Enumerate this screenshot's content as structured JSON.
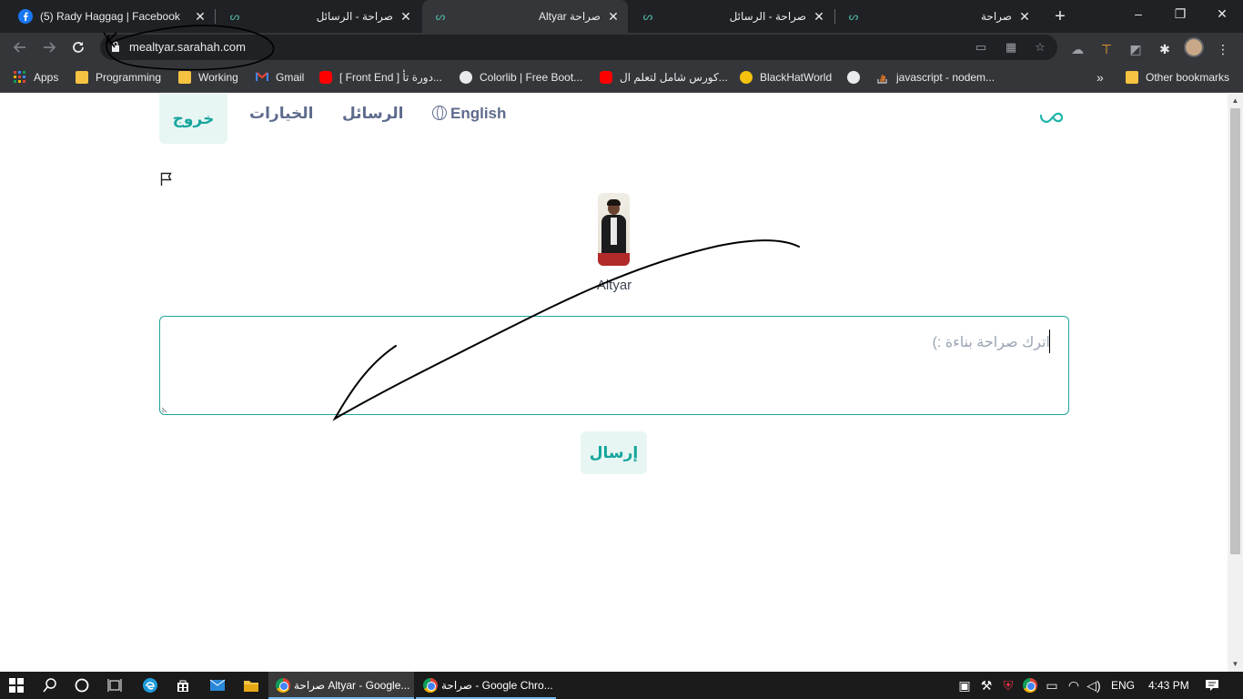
{
  "browser": {
    "tabs": [
      {
        "title": "(5) Rady Haggag | Facebook",
        "favicon": "facebook-icon"
      },
      {
        "title": "صراحة - الرسائل",
        "favicon": "sarahah-icon"
      },
      {
        "title": "Altyar صراحة",
        "favicon": "sarahah-icon"
      },
      {
        "title": "صراحة - الرسائل",
        "favicon": "sarahah-icon"
      },
      {
        "title": "صراحة",
        "favicon": "sarahah-icon"
      }
    ],
    "new_tab": "+",
    "window_controls": {
      "minimize": "–",
      "maximize": "❐",
      "close": "✕"
    },
    "url": "mealtyar.sarahah.com",
    "bookmarks": [
      {
        "label": "Apps",
        "icon": "apps-grid-icon"
      },
      {
        "label": "Programming",
        "icon": "folder-icon"
      },
      {
        "label": "Working",
        "icon": "folder-icon"
      },
      {
        "label": "Gmail",
        "icon": "gmail-icon"
      },
      {
        "label": "[ Front End ] دورة تأ...",
        "icon": "youtube-icon"
      },
      {
        "label": "Colorlib | Free Boot...",
        "icon": "wordpress-icon"
      },
      {
        "label": "كورس شامل لتعلم ال...",
        "icon": "youtube-icon"
      },
      {
        "label": "BlackHatWorld",
        "icon": "bhw-icon"
      },
      {
        "label": "",
        "icon": "globe-icon"
      },
      {
        "label": "javascript - nodem...",
        "icon": "stackoverflow-icon"
      }
    ],
    "bookmarks_overflow": "»",
    "other_bookmarks": "Other bookmarks"
  },
  "site": {
    "nav": {
      "logout": "خروج",
      "options": "الخيارات",
      "messages": "الرسائل",
      "language": "English"
    },
    "profile": {
      "name": "Altyar"
    },
    "message": {
      "placeholder": "اترك صراحة بناءة :)"
    },
    "send_button": "إرسال"
  },
  "taskbar": {
    "apps": [
      {
        "label": "صراحة Altyar - Google...",
        "active": true
      },
      {
        "label": "صراحة - Google Chro...",
        "active": false
      }
    ],
    "language": "ENG",
    "time": "4:43 PM"
  },
  "colors": {
    "accent": "#16a59c",
    "accent_light": "#e7f6f3",
    "nav_text": "#5e6b8d",
    "browser_dark": "#202124",
    "browser_toolbar": "#35363a"
  }
}
